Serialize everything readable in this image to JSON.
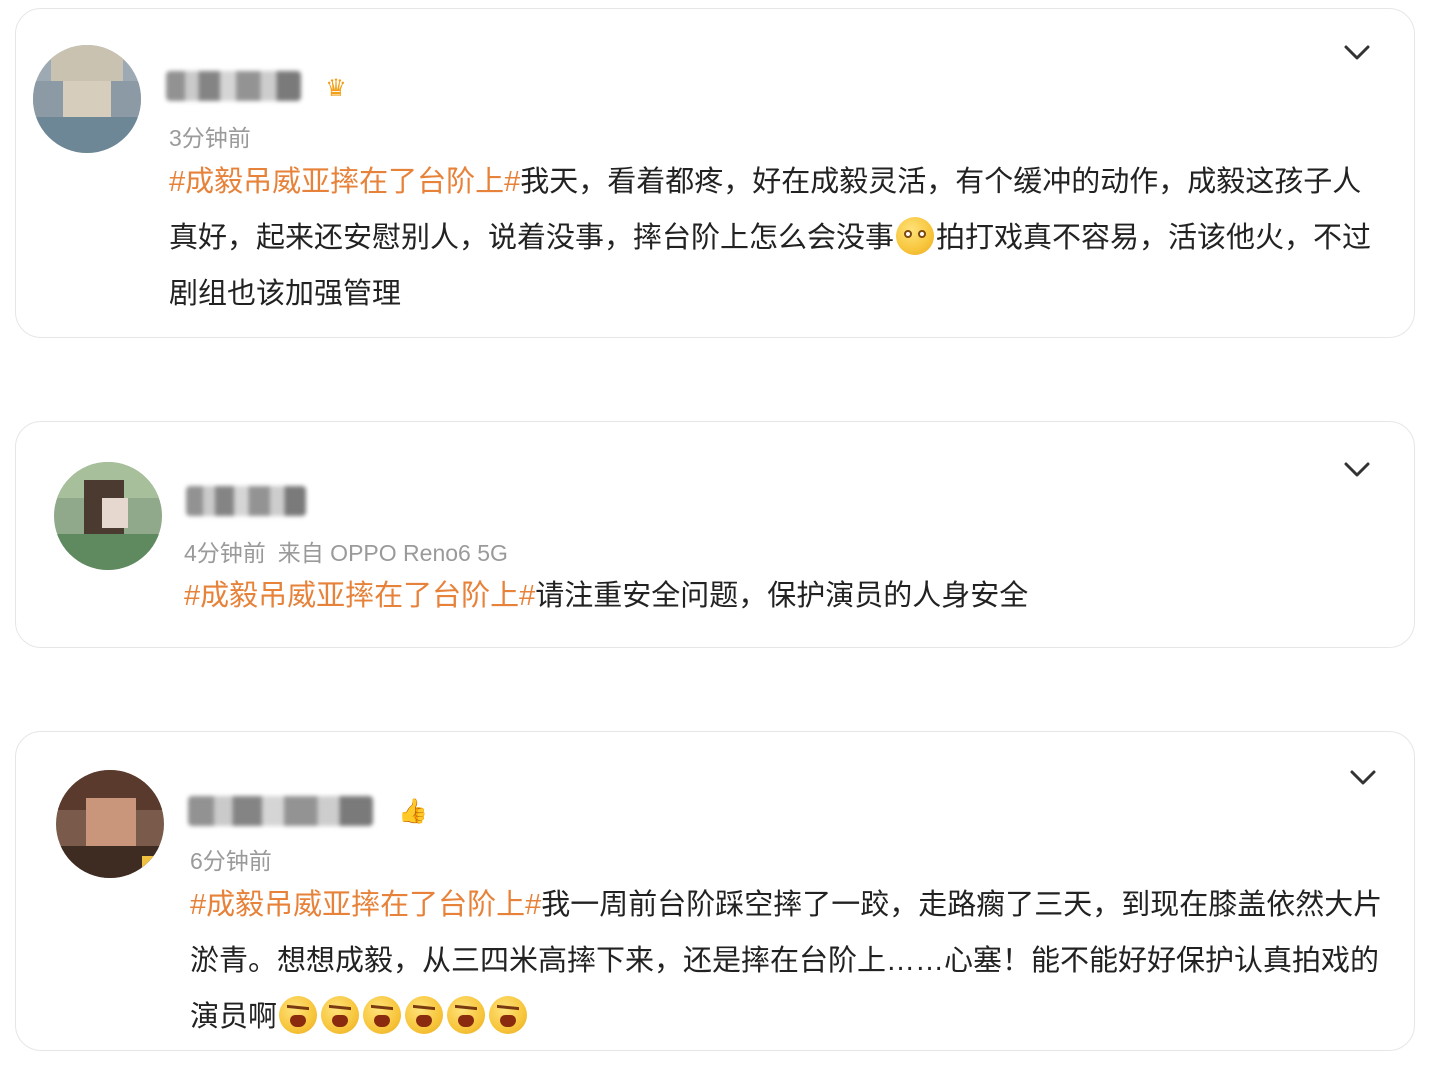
{
  "comments": [
    {
      "time": "3分钟前",
      "device": "",
      "badge_icon": "crown-icon",
      "hashtag": "#成毅吊威亚摔在了台阶上#",
      "text_a": "我天，看着都疼，好在成毅灵活，有个缓冲的动作，成毅这孩子人真好，起来还安慰别人，说着没事，摔台阶上怎么会没事",
      "text_b": "拍打戏真不容易，活该他火，不过剧组也该加强管理"
    },
    {
      "time": "4分钟前",
      "device": "来自 OPPO Reno6 5G",
      "hashtag": "#成毅吊威亚摔在了台阶上#",
      "text_a": "请注重安全问题，保护演员的人身安全"
    },
    {
      "time": "6分钟前",
      "device": "",
      "badge_icon": "thumbs-up-icon",
      "hashtag": "#成毅吊威亚摔在了台阶上#",
      "text_a": "我一周前台阶踩空摔了一跤，走路瘸了三天，到现在膝盖依然大片淤青。想想成毅，从三四米高摔下来，还是摔在台阶上……心塞！能不能好好保护认真拍戏的演员啊"
    }
  ],
  "colors": {
    "hashtag": "#e7823a",
    "text": "#222222",
    "meta": "#9a9a9a",
    "border": "#e6e6e6"
  }
}
